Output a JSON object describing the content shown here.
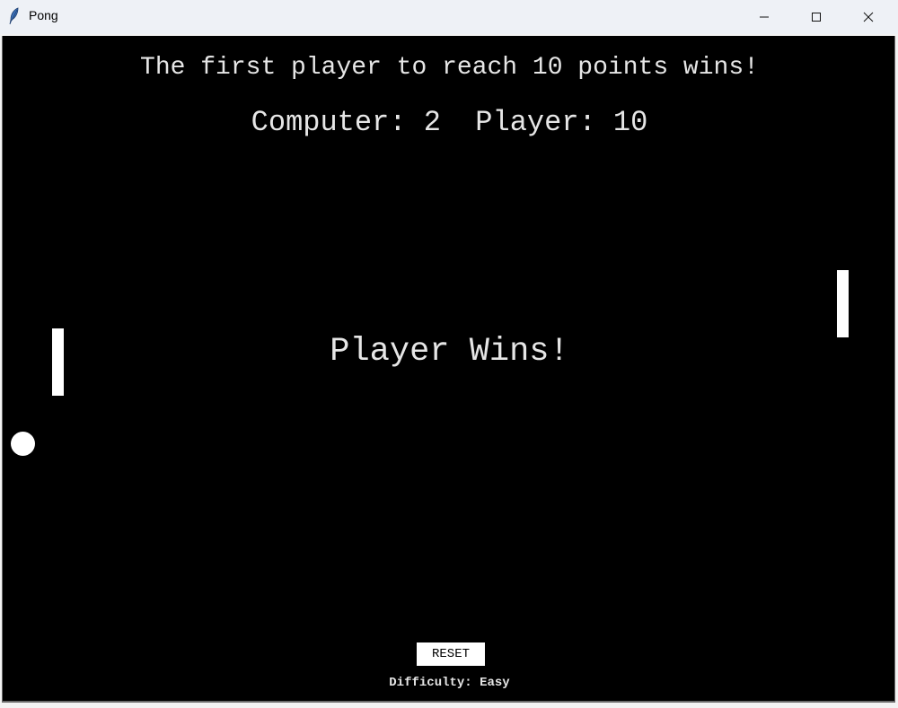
{
  "window": {
    "title": "Pong",
    "app_icon": "feather-icon",
    "controls": {
      "minimize_icon": "minimize-icon",
      "maximize_icon": "maximize-icon",
      "close_icon": "close-icon"
    }
  },
  "game": {
    "instructions": "The first player to reach 10 points wins!",
    "score": {
      "computer_label": "Computer:",
      "computer_value": "2",
      "player_label": "Player:",
      "player_value": "10"
    },
    "winner_message": "Player Wins!",
    "reset_label": "RESET",
    "difficulty_text": "Difficulty: Easy"
  },
  "colors": {
    "background": "#000000",
    "foreground": "#ffffff",
    "text": "#e6e6e6"
  }
}
